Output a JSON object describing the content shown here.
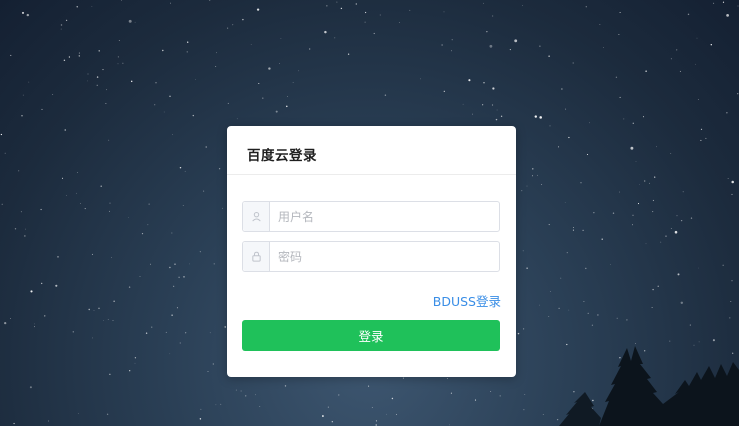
{
  "login": {
    "title": "百度云登录",
    "username": {
      "placeholder": "用户名",
      "value": "",
      "icon": "user-icon"
    },
    "password": {
      "placeholder": "密码",
      "value": "",
      "icon": "lock-icon"
    },
    "bduss_link_label": "BDUSS登录",
    "submit_label": "登录"
  },
  "colors": {
    "accent": "#1fc15a",
    "link": "#3a8ee6",
    "background": "#1c2b3d"
  }
}
